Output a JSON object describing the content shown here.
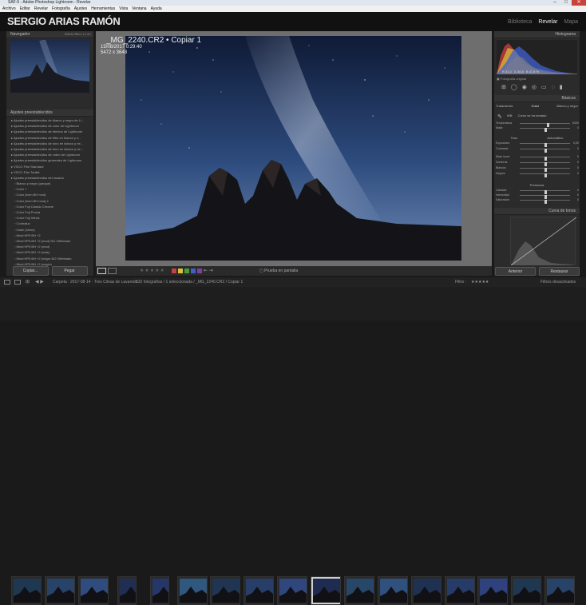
{
  "window": {
    "title": "SAF-5 - Adobe Photoshop Lightroom - Revelar"
  },
  "menu": [
    "Archivo",
    "Editar",
    "Revelar",
    "Fotografía",
    "Ajustes",
    "Herramientas",
    "Vista",
    "Ventana",
    "Ayuda"
  ],
  "identity": {
    "plate": "SERGIO ARIAS RAMÓN",
    "modules": [
      "Biblioteca",
      "Revelar",
      "Mapa"
    ]
  },
  "navigator": {
    "title": "Navegador",
    "zoom": [
      "ENCAJ",
      "RELL",
      "1:1",
      "3:1"
    ]
  },
  "presets": {
    "title": "Ajustes preestablecidos",
    "items": [
      "Ajustes preestablecidos de blanco y negro de Li...",
      "Ajustes preestablecidos de color de Lightroom",
      "Ajustes preestablecidos de efectos de Lightroom",
      "Ajustes preestablecidos de filtro en blanco y n...",
      "Ajustes preestablecidos de tono en blanco y ne...",
      "Ajustes preestablecidos de tono en blanco y ne...",
      "Ajustes preestablecidos de vídeo de Lightroom",
      "Ajustes preestablecidos generales de Lightroom",
      "VSCO Film Standard",
      "VSCO Film Toolkit",
      "Ajustes preestablecidos del usuario",
      "Blanco y negro (parque)",
      "Color +",
      "Color (from BH mod)",
      "Color (from BH mod) 2",
      "Color Fuji Classic Chrome",
      "Color Fuji Provia",
      "Color Fuji Velvia",
      "Contraluz",
      "Gaén (Nene)",
      "Ilford HP5 BH +2",
      "Ilford HP5 BH +2 (mod) NO Viñeteado",
      "Ilford HP5 BH +2 (mod)",
      "Ilford HP5 BH +2 (más)",
      "Ilford HP5 BH +2 (negro NO Viñeteado",
      "Ilford HP5 BH +2 (negro)"
    ]
  },
  "left_buttons": {
    "copy": "Copiar...",
    "paste": "Pegar"
  },
  "photo": {
    "filename": "_MG_2240.CR2 • Copiar 1",
    "datetime": "15/08/2017 0:29:40",
    "size": "5472 x 3648"
  },
  "toolbar": {
    "softproof": "Prueba en pantalla",
    "colors": [
      "#c84040",
      "#d8c040",
      "#40a040",
      "#4060c8",
      "#8040a0"
    ]
  },
  "right": {
    "histogram_title": "Histograma",
    "histogram_readout": "ISO 3200   14 mm   f / 2,8   20 seg",
    "readout_values": [
      "R 31,0",
      "G 38,8",
      "B 47,8 %"
    ],
    "original_photo": "Fotografía original",
    "basicos": "Básicos",
    "treatment": [
      "Tratamiento:",
      "Color",
      "Blanco y negro"
    ],
    "wb_label": "WB:",
    "wb_value": "Como se ha tomado",
    "tone_label": "Tono",
    "auto": "Automático",
    "sliders": [
      {
        "label": "Temperatura",
        "value": "5300",
        "pos": 0.55
      },
      {
        "label": "Matiz",
        "value": "0",
        "pos": 0.5
      },
      {
        "label": "Exposición",
        "value": "0,00",
        "pos": 0.5
      },
      {
        "label": "Contraste",
        "value": "0",
        "pos": 0.5
      },
      {
        "label": "Altas luces",
        "value": "0",
        "pos": 0.5
      },
      {
        "label": "Sombras",
        "value": "0",
        "pos": 0.5
      },
      {
        "label": "Blancos",
        "value": "0",
        "pos": 0.5
      },
      {
        "label": "Negros",
        "value": "0",
        "pos": 0.5
      }
    ],
    "presence": "Presencia",
    "presence_sliders": [
      {
        "label": "Claridad",
        "value": "0",
        "pos": 0.5
      },
      {
        "label": "Intensidad",
        "value": "0",
        "pos": 0.5
      },
      {
        "label": "Saturación",
        "value": "0",
        "pos": 0.5
      }
    ],
    "curve_title": "Curva de tonos",
    "prev": "Anterior",
    "reset": "Restaurar"
  },
  "filmstrip": {
    "path": "Carpeta : 2017-08-14 - Tres Cimas de Lavaredo",
    "count": "132 fotografías / 1 seleccionada / _MG_2240.CR2 / Copiar 1",
    "filter": "Filtro :",
    "filter_value": "Filtros desactivados"
  }
}
